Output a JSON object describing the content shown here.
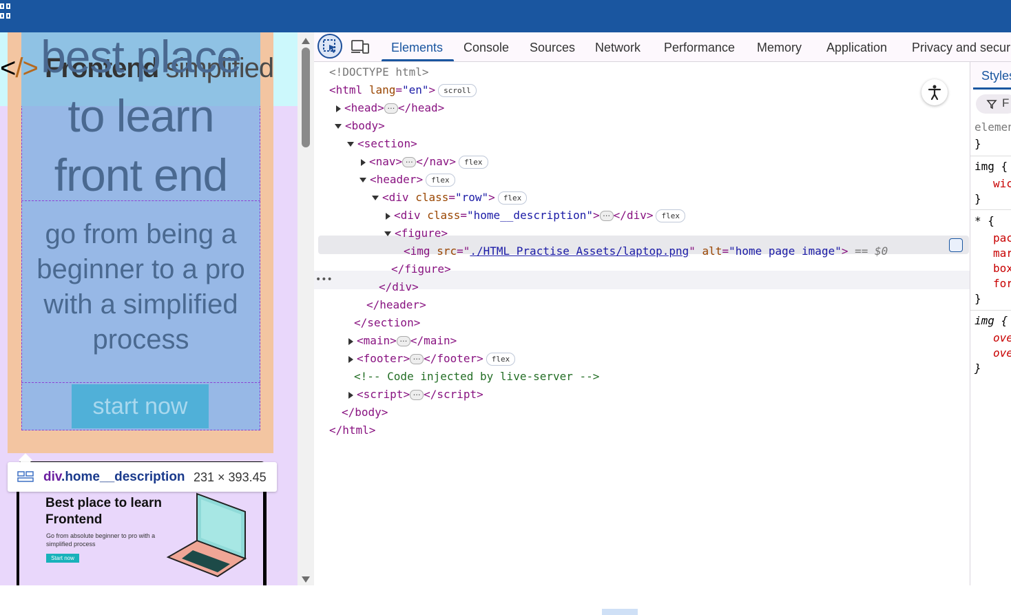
{
  "browser": {
    "apps_icon": "apps-grid-icon"
  },
  "page_preview": {
    "nav_text": {
      "open": "<",
      "slash": "/>",
      "brand": "Frontend",
      "rest": "simplified"
    },
    "title_lines": [
      "best place",
      "to learn",
      "front end"
    ],
    "subtitle": "go from being a beginner to a pro with a simplified process",
    "cta": "start now",
    "tooltip": {
      "tag": "div",
      "class": ".home__description",
      "size": "231 × 393.45"
    },
    "card": {
      "title": "Best place to learn Frontend",
      "subtitle": "Go from absolute beginner to pro with a simplified process",
      "button": "Start now"
    }
  },
  "devtools": {
    "tabs": [
      "Elements",
      "Console",
      "Sources",
      "Network",
      "Performance",
      "Memory",
      "Application",
      "Privacy and securi"
    ],
    "active_tab": "Elements",
    "styles_tab": "Styles",
    "styles_filter": "F",
    "badges": {
      "scroll": "scroll",
      "flex": "flex"
    },
    "dom": {
      "doctype": "<!DOCTYPE html>",
      "html_open": "<html",
      "lang_attr": "lang",
      "lang_val": "\"en\"",
      "head": "head",
      "body": "body",
      "section": "section",
      "nav": "nav",
      "header": "header",
      "div": "div",
      "class_attr": "class",
      "row_val": "\"row\"",
      "desc_val": "\"home__description\"",
      "figure": "figure",
      "img": "img",
      "src_attr": "src",
      "src_val": "./HTML Practise Assets/laptop.png",
      "alt_attr": "alt",
      "alt_val": "\"home page image\"",
      "selected_marker": "== $0",
      "main": "main",
      "footer": "footer",
      "comment": "<!-- Code injected by live-server -->",
      "script": "script"
    },
    "styles_rules": [
      {
        "selector": "elemen",
        "props": []
      },
      {
        "selector": "img {",
        "props": [
          "wic"
        ]
      },
      {
        "selector": "* {",
        "props": [
          "pac",
          "mar",
          "box",
          "for"
        ]
      },
      {
        "selector": "img {",
        "props": [
          "ove",
          "ove"
        ]
      }
    ]
  }
}
